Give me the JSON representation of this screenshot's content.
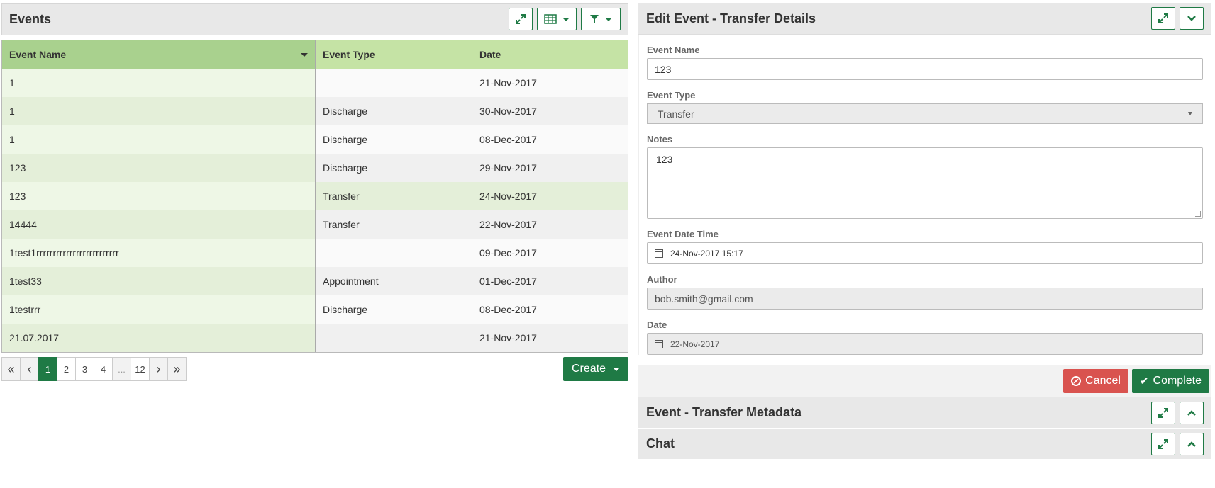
{
  "events_panel": {
    "title": "Events",
    "columns": [
      "Event Name",
      "Event Type",
      "Date"
    ],
    "rows": [
      {
        "name": "1",
        "type": "",
        "date": "21-Nov-2017"
      },
      {
        "name": "1",
        "type": "Discharge",
        "date": "30-Nov-2017"
      },
      {
        "name": "1",
        "type": "Discharge",
        "date": "08-Dec-2017"
      },
      {
        "name": "123",
        "type": "Discharge",
        "date": "29-Nov-2017"
      },
      {
        "name": "123",
        "type": "Transfer",
        "date": "24-Nov-2017"
      },
      {
        "name": "14444",
        "type": "Transfer",
        "date": "22-Nov-2017"
      },
      {
        "name": "1test1rrrrrrrrrrrrrrrrrrrrrrrrr",
        "type": "",
        "date": "09-Dec-2017"
      },
      {
        "name": "1test33",
        "type": "Appointment",
        "date": "01-Dec-2017"
      },
      {
        "name": "1testrrr",
        "type": "Discharge",
        "date": "08-Dec-2017"
      },
      {
        "name": "21.07.2017",
        "type": "",
        "date": "21-Nov-2017"
      }
    ],
    "pager": {
      "first": "«",
      "prev": "‹",
      "pages": [
        "1",
        "2",
        "3",
        "4"
      ],
      "ellipsis": "...",
      "last_page": "12",
      "next": "›",
      "last": "»",
      "current": "1"
    },
    "create_label": "Create"
  },
  "edit_panel": {
    "title": "Edit Event - Transfer Details",
    "event_name_label": "Event Name",
    "event_name_value": "123",
    "event_type_label": "Event Type",
    "event_type_value": "Transfer",
    "notes_label": "Notes",
    "notes_value": "123",
    "event_datetime_label": "Event Date Time",
    "event_datetime_value": "24-Nov-2017 15:17",
    "author_label": "Author",
    "author_value": "bob.smith@gmail.com",
    "date_label": "Date",
    "date_value": "22-Nov-2017",
    "cancel_label": "Cancel",
    "complete_label": "Complete"
  },
  "metadata_panel": {
    "title": "Event - Transfer Metadata"
  },
  "chat_panel": {
    "title": "Chat"
  },
  "colors": {
    "accent": "#1f7a45",
    "danger": "#d9534f",
    "header_green": "#a9d18e",
    "header_light_green": "#c5e3a5"
  },
  "icons": [
    "expand-icon",
    "table-icon",
    "filter-icon",
    "chevron-down-icon",
    "chevron-up-icon",
    "calendar-icon",
    "ban-icon",
    "check-icon"
  ]
}
